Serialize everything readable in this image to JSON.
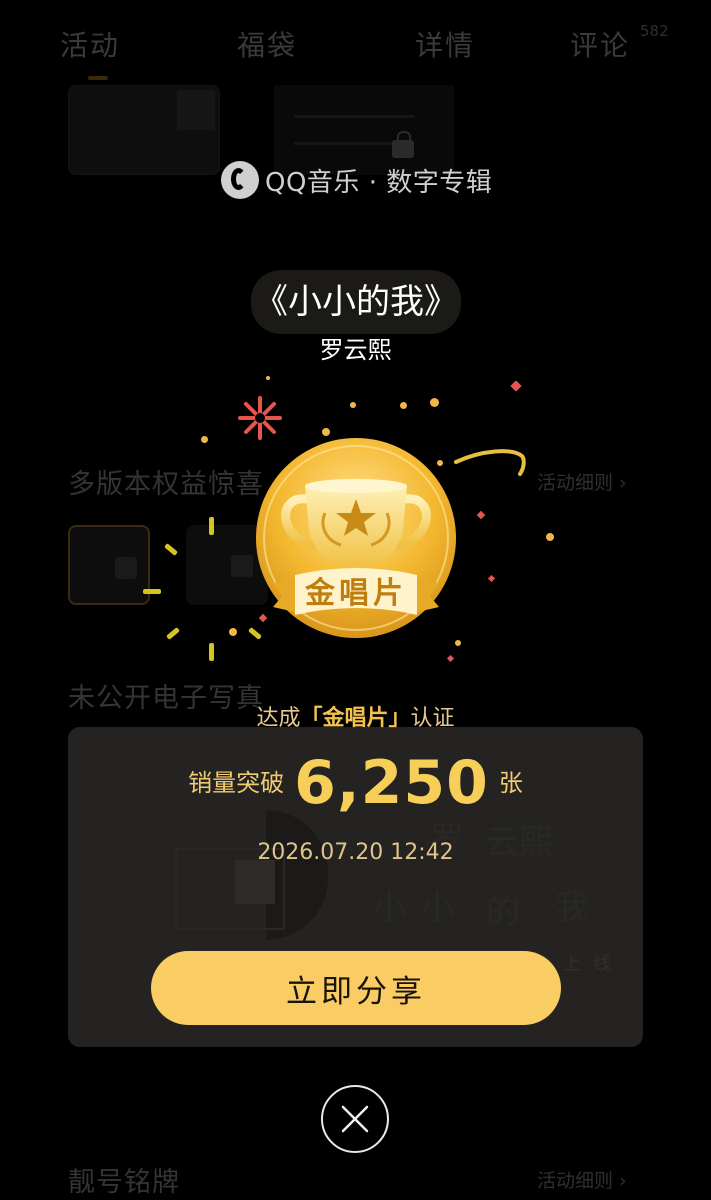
{
  "background": {
    "tabs": [
      "活动",
      "福袋",
      "详情",
      "评论"
    ],
    "comment_count": "582",
    "section_multi_version": "多版本权益惊喜",
    "section_photos": "未公开电子写真",
    "section_badge": "靓号铭牌",
    "rules_link": "活动细则",
    "bg_art_chars": [
      "罗",
      "云熙",
      "小",
      "小",
      "的",
      "我"
    ],
    "bg_online": "上线"
  },
  "overlay": {
    "brand": "QQ音乐 · 数字专辑",
    "album_title": "《小小的我》",
    "artist": "罗云熙",
    "medal_label": "金唱片",
    "cert_prefix": "达成",
    "cert_highlight": "「金唱片」",
    "cert_suffix": "认证",
    "sales_label": "销量突破",
    "sales_value": "6,250",
    "sales_unit": "张",
    "timestamp": "2026.07.20 12:42",
    "share_button": "立即分享"
  },
  "colors": {
    "gold": "#f7cf58",
    "button": "#f9cd63",
    "medal_dark": "#c88a14"
  }
}
